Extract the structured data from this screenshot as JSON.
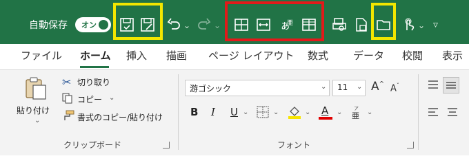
{
  "qat": {
    "autosave_label": "自動保存",
    "autosave_state": "オン",
    "bg_color": "#217346",
    "highlight_colors": [
      "#f2e600",
      "#e21a1a"
    ]
  },
  "tabs": [
    {
      "label": "ファイル"
    },
    {
      "label": "ホーム"
    },
    {
      "label": "挿入"
    },
    {
      "label": "描画"
    },
    {
      "label": "ページ レイアウト"
    },
    {
      "label": "数式"
    },
    {
      "label": "データ"
    },
    {
      "label": "校閲"
    },
    {
      "label": "表示"
    }
  ],
  "clipboard": {
    "paste_label": "貼り付け",
    "cut_label": "切り取り",
    "copy_label": "コピー",
    "format_painter_label": "書式のコピー/貼り付け",
    "group_label": "クリップボード"
  },
  "font": {
    "font_name": "游ゴシック",
    "font_size": "11",
    "bold": "B",
    "italic": "I",
    "underline": "U",
    "font_color_letter": "A",
    "group_label": "フォント"
  }
}
